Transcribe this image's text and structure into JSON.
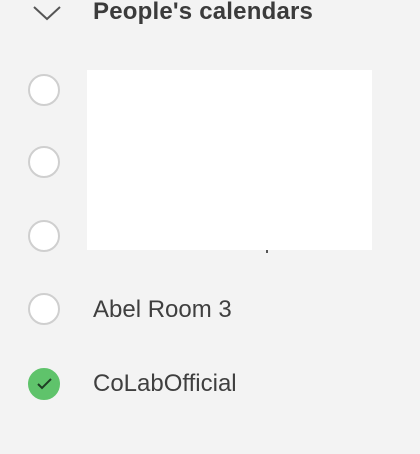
{
  "group": {
    "title": "People's calendars",
    "expand_icon": "chevron-down-icon"
  },
  "calendars": [
    {
      "label": "",
      "checked": false
    },
    {
      "label": "",
      "checked": false
    },
    {
      "label": "",
      "checked": false
    },
    {
      "label": "Abel Room 3",
      "checked": false
    },
    {
      "label": "CoLabOfficial",
      "checked": true
    }
  ],
  "colors": {
    "background": "#f3f3f3",
    "checked_accent": "#5fc36b",
    "radio_border": "#cfcfcf",
    "text": "#3f3f3f"
  }
}
